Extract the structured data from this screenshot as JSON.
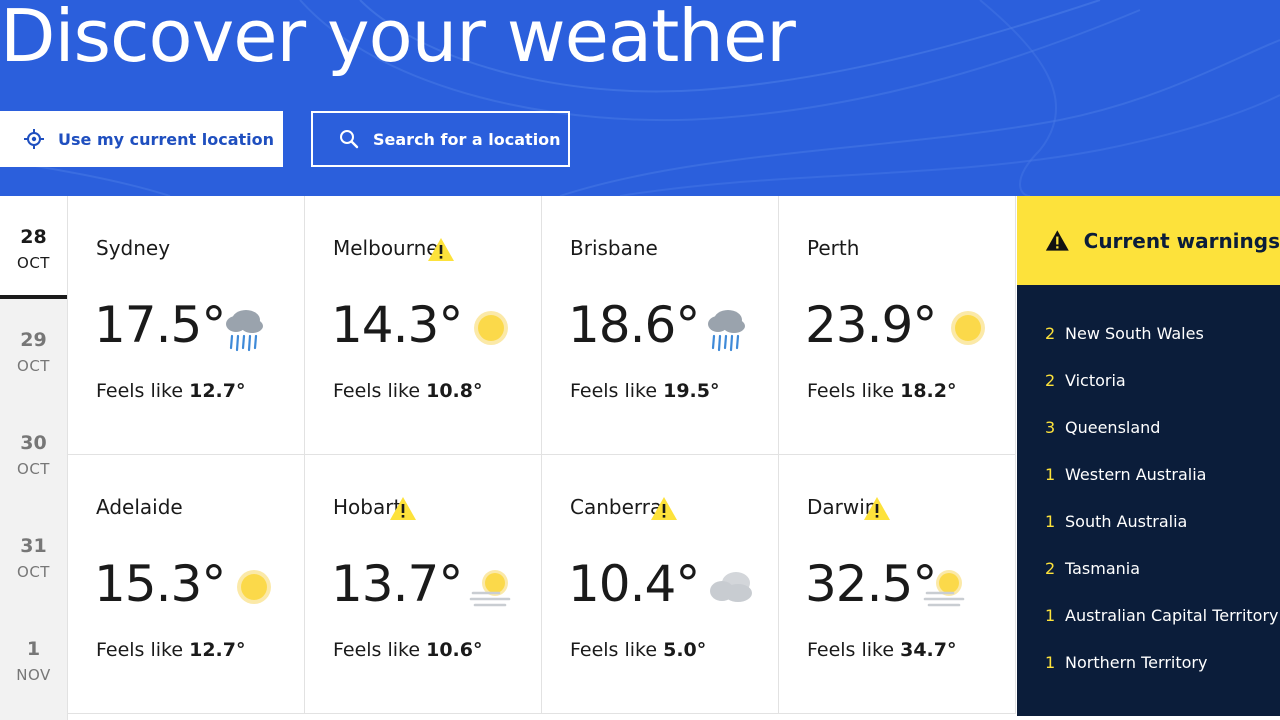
{
  "hero": {
    "title": "Discover your weather",
    "location_button": "Use my current location",
    "search_button": "Search for a location"
  },
  "dates": [
    {
      "day": "28",
      "month": "OCT",
      "active": true
    },
    {
      "day": "29",
      "month": "OCT",
      "active": false
    },
    {
      "day": "30",
      "month": "OCT",
      "active": false
    },
    {
      "day": "31",
      "month": "OCT",
      "active": false
    },
    {
      "day": "1",
      "month": "NOV",
      "active": false
    }
  ],
  "cities": [
    {
      "name": "Sydney",
      "warning": false,
      "temp": "17.5°",
      "feels_prefix": "Feels like",
      "feels": "12.7°",
      "icon": "rain-icon"
    },
    {
      "name": "Melbourne",
      "warning": true,
      "temp": "14.3°",
      "feels_prefix": "Feels like",
      "feels": "10.8°",
      "icon": "sunny-icon"
    },
    {
      "name": "Brisbane",
      "warning": false,
      "temp": "18.6°",
      "feels_prefix": "Feels like",
      "feels": "19.5°",
      "icon": "rain-icon"
    },
    {
      "name": "Perth",
      "warning": false,
      "temp": "23.9°",
      "feels_prefix": "Feels like",
      "feels": "18.2°",
      "icon": "sunny-icon"
    },
    {
      "name": "Adelaide",
      "warning": false,
      "temp": "15.3°",
      "feels_prefix": "Feels like",
      "feels": "12.7°",
      "icon": "sunny-icon"
    },
    {
      "name": "Hobart",
      "warning": true,
      "temp": "13.7°",
      "feels_prefix": "Feels like",
      "feels": "10.6°",
      "icon": "hazy-sun-icon"
    },
    {
      "name": "Canberra",
      "warning": true,
      "temp": "10.4°",
      "feels_prefix": "Feels like",
      "feels": "5.0°",
      "icon": "cloudy-icon"
    },
    {
      "name": "Darwin",
      "warning": true,
      "temp": "32.5°",
      "feels_prefix": "Feels like",
      "feels": "34.7°",
      "icon": "hazy-sun-icon"
    }
  ],
  "warnings": {
    "title": "Current warnings",
    "items": [
      {
        "count": "2",
        "region": "New South Wales"
      },
      {
        "count": "2",
        "region": "Victoria"
      },
      {
        "count": "3",
        "region": "Queensland"
      },
      {
        "count": "1",
        "region": "Western Australia"
      },
      {
        "count": "1",
        "region": "South Australia"
      },
      {
        "count": "2",
        "region": "Tasmania"
      },
      {
        "count": "1",
        "region": "Australian Capital Territory"
      },
      {
        "count": "1",
        "region": "Northern Territory"
      }
    ]
  },
  "colors": {
    "hero_blue": "#2b5fdc",
    "warning_yellow": "#fde23b",
    "panel_navy": "#0b1d3a",
    "sun": "#fbd94a"
  }
}
